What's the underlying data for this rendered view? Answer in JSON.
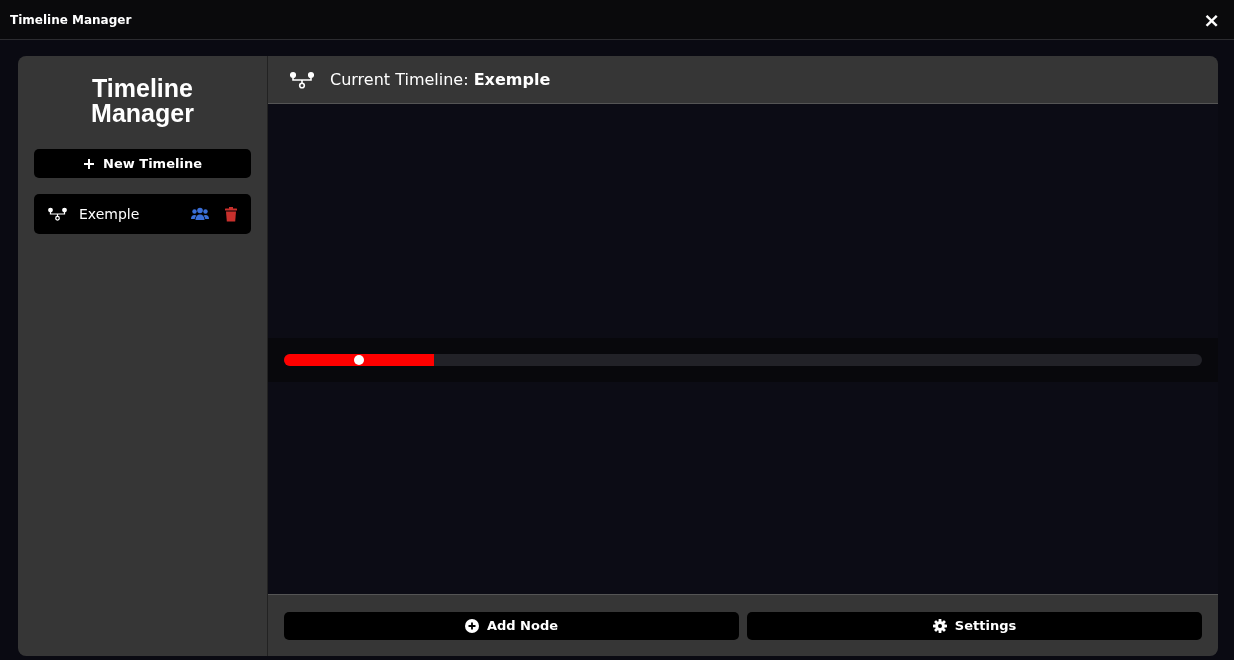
{
  "window": {
    "title": "Timeline Manager",
    "close": "×"
  },
  "sidebar": {
    "title": "Timeline Manager",
    "new_button": "New Timeline",
    "items": [
      {
        "label": "Exemple",
        "selected": true
      }
    ]
  },
  "header": {
    "label": "Current Timeline:",
    "name": "Exemple"
  },
  "timeline": {
    "level": 0.163
  },
  "buttons": [
    {
      "kind": "add",
      "label": "Add Node"
    },
    {
      "kind": "settings",
      "label": "Settings"
    }
  ]
}
